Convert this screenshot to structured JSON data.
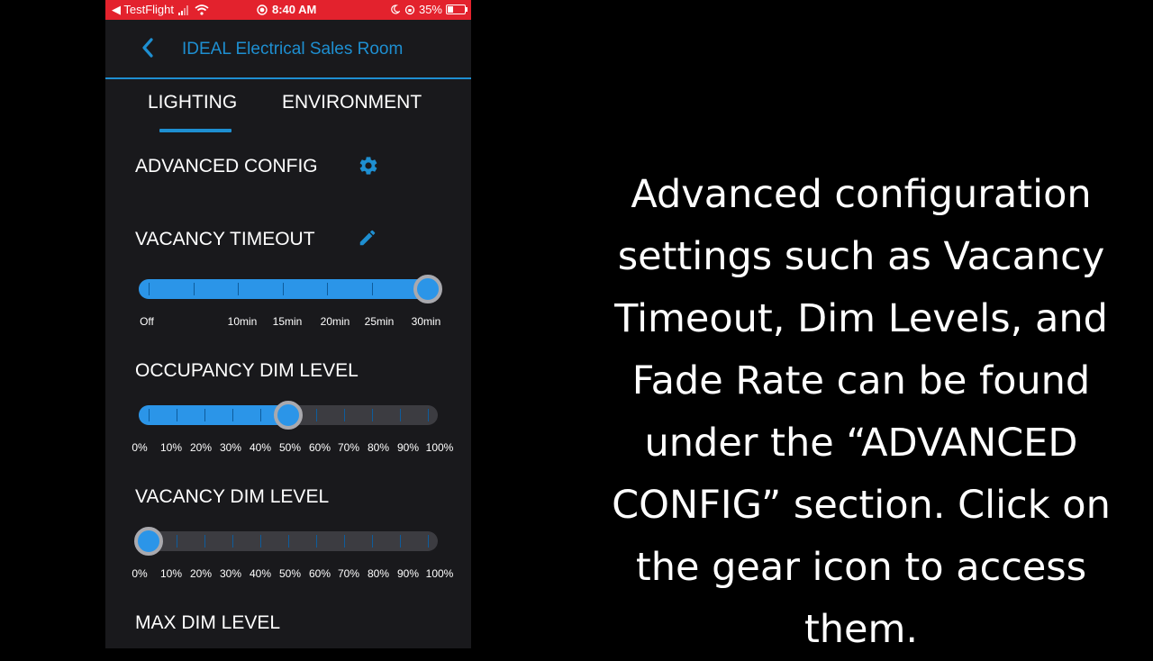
{
  "status_bar": {
    "back_app": "◀ TestFlight",
    "time": "8:40 AM",
    "battery": "35%"
  },
  "header": {
    "title": "IDEAL Electrical Sales Room"
  },
  "tabs": [
    {
      "label": "LIGHTING",
      "active": true
    },
    {
      "label": "ENVIRONMENT",
      "active": false
    }
  ],
  "sections": {
    "advanced_config": {
      "label": "ADVANCED CONFIG",
      "icon": "gear-icon"
    },
    "vacancy_timeout": {
      "label": "VACANCY TIMEOUT",
      "icon": "pencil-icon",
      "value_fraction": 1.0,
      "tick_labels": [
        "Off",
        "10min",
        "15min",
        "20min",
        "25min",
        "30min"
      ]
    },
    "occupancy_dim_level": {
      "label": "OCCUPANCY DIM LEVEL",
      "value_percent": 50,
      "tick_labels": [
        "0%",
        "10%",
        "20%",
        "30%",
        "40%",
        "50%",
        "60%",
        "70%",
        "80%",
        "90%",
        "100%"
      ]
    },
    "vacancy_dim_level": {
      "label": "VACANCY DIM LEVEL",
      "value_percent": 0,
      "tick_labels": [
        "0%",
        "10%",
        "20%",
        "30%",
        "40%",
        "50%",
        "60%",
        "70%",
        "80%",
        "90%",
        "100%"
      ]
    },
    "max_dim_level": {
      "label": "MAX DIM LEVEL"
    }
  },
  "caption": {
    "text": "Advanced configuration settings such as Vacancy Timeout, Dim Levels, and Fade Rate can be found under the “ADVANCED CONFIG” section. Click on the gear icon to access them."
  },
  "colors": {
    "accent": "#1e8fd1",
    "status_bar": "#e3222d",
    "panel_bg": "#19191c"
  }
}
